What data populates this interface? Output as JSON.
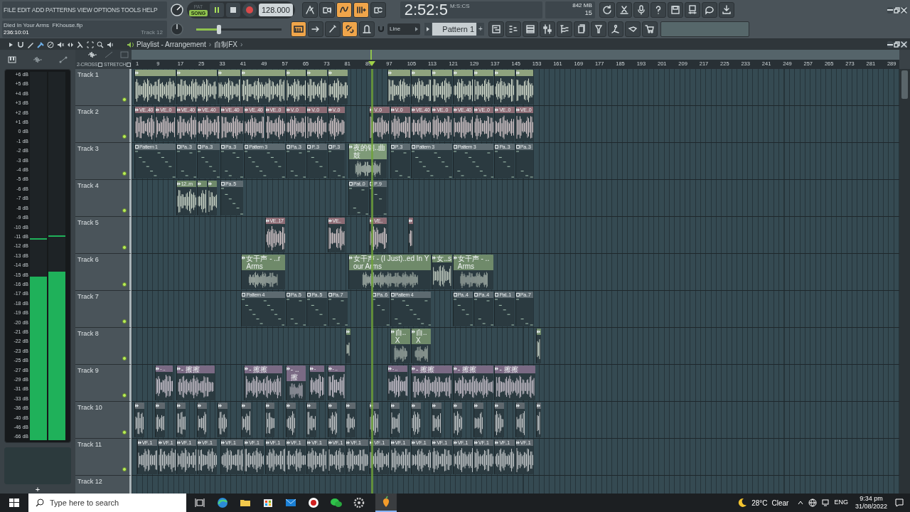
{
  "menu": [
    "FILE",
    "EDIT",
    "ADD",
    "PATTERNS",
    "VIEW",
    "OPTIONS",
    "TOOLS",
    "HELP"
  ],
  "transport": {
    "modes": [
      {
        "label": "PAT",
        "selected": false
      },
      {
        "label": "SONG",
        "selected": true
      }
    ],
    "playing": true,
    "tempo": "128.000"
  },
  "record_toggles": [
    {
      "on": false
    },
    {
      "on": false
    },
    {
      "on": true
    },
    {
      "on": true
    },
    {
      "on": false
    }
  ],
  "clock": {
    "time": "2:52:5",
    "unit": "M:S:CS"
  },
  "monitor": {
    "memory": "842 MB",
    "cpu": "15"
  },
  "hint": {
    "title": "Died In Your Arms  FKhouse.flp",
    "time": "236:10:01",
    "target": "Track 12"
  },
  "master_volume": {
    "level": 0.27
  },
  "snap_toggles": [
    {
      "on": true
    },
    {
      "on": false
    },
    {
      "on": false
    },
    {
      "on": true
    },
    {
      "on": false
    }
  ],
  "snap": {
    "value": "Line"
  },
  "pattern": {
    "name": "Pattern 1",
    "add": "+"
  },
  "playlist": {
    "title": "Playlist - Arrangement",
    "separator": "›",
    "folder": "自制FX",
    "trail": "›",
    "options": [
      {
        "label": "2-CROSS",
        "checked": false
      },
      {
        "label": "STRETCH",
        "checked": false
      }
    ],
    "ruler": [
      "1",
      "9",
      "17",
      "25",
      "33",
      "41",
      "49",
      "57",
      "65",
      "73",
      "81",
      "89",
      "97",
      "105",
      "113",
      "121",
      "129",
      "137",
      "145",
      "153",
      "161",
      "169",
      "177",
      "185",
      "193",
      "201",
      "209",
      "217",
      "225",
      "233",
      "241",
      "249",
      "257",
      "265",
      "273",
      "281",
      "289"
    ],
    "playhead": {
      "level": 0.311
    },
    "tracks": [
      {
        "name": "Track 1",
        "enabled": true,
        "color": "#8fa37e",
        "clips": [
          {
            "kind": "audio"
          },
          {
            "kind": "audio"
          },
          {
            "kind": "audio"
          },
          {
            "kind": "audio"
          },
          {
            "kind": "audio"
          },
          {
            "kind": "audio"
          },
          {
            "kind": "audio"
          },
          {
            "kind": "audio"
          },
          {
            "kind": "audio"
          },
          {
            "kind": "audio"
          },
          {
            "kind": "audio"
          },
          {
            "kind": "audio"
          },
          {
            "kind": "audio"
          },
          {
            "kind": "audio"
          }
        ]
      },
      {
        "name": "Track 2",
        "enabled": true,
        "color": "#8c6b74",
        "clips": [
          {
            "kind": "audio",
            "label": "VE..40"
          },
          {
            "kind": "audio",
            "label": "VE..0"
          },
          {
            "kind": "audio",
            "label": "VE..40"
          },
          {
            "kind": "audio",
            "label": "VE..40"
          },
          {
            "kind": "audio",
            "label": "VE..40"
          },
          {
            "kind": "audio",
            "label": "VE..40"
          },
          {
            "kind": "audio",
            "label": "VE..0"
          },
          {
            "kind": "audio",
            "label": "V..0"
          },
          {
            "kind": "audio",
            "label": "V..0"
          },
          {
            "kind": "audio",
            "label": "V..0"
          },
          {
            "kind": "audio",
            "label": "V..0"
          },
          {
            "kind": "audio",
            "label": "V..0"
          },
          {
            "kind": "audio",
            "label": "VE..40"
          },
          {
            "kind": "audio",
            "label": "VE..0"
          },
          {
            "kind": "audio",
            "label": "VE..40"
          },
          {
            "kind": "audio",
            "label": "VE..0"
          },
          {
            "kind": "audio",
            "label": "VE..0"
          },
          {
            "kind": "audio",
            "label": "VE..0"
          }
        ]
      },
      {
        "name": "Track 3",
        "enabled": true,
        "color": "#5d6a70",
        "clips": [
          {
            "kind": "pattern",
            "label": "Pattern 1"
          },
          {
            "kind": "pattern",
            "label": "Pa..3"
          },
          {
            "kind": "pattern",
            "label": "Pa..3"
          },
          {
            "kind": "pattern",
            "label": "Pa..3"
          },
          {
            "kind": "pattern",
            "label": "Pattern 3"
          },
          {
            "kind": "pattern",
            "label": "Pa..3"
          },
          {
            "kind": "pattern",
            "label": "P..3"
          },
          {
            "kind": "pattern",
            "label": "P..3"
          },
          {
            "kind": "audio",
            "label": "夜的钢..曲鼓",
            "color": "#7e9a78"
          },
          {
            "kind": "pattern",
            "label": "P..3"
          },
          {
            "kind": "pattern",
            "label": "Pattern 3"
          },
          {
            "kind": "pattern",
            "label": "Pattern 3"
          },
          {
            "kind": "pattern",
            "label": "Pa..3"
          },
          {
            "kind": "pattern",
            "label": "Pa..3"
          }
        ]
      },
      {
        "name": "Track 4",
        "enabled": true,
        "color": "#6f8a6a",
        "clips": [
          {
            "kind": "audio",
            "label": "12..m"
          },
          {
            "kind": "audio"
          },
          {
            "kind": "audio"
          },
          {
            "kind": "pattern",
            "label": "Pa..5",
            "color": "#5d6a70"
          },
          {
            "kind": "pattern",
            "label": "Pat..0",
            "color": "#5d6a70"
          },
          {
            "kind": "pattern",
            "label": "P..9",
            "color": "#5d6a70"
          }
        ]
      },
      {
        "name": "Track 5",
        "enabled": true,
        "color": "#8c6b74",
        "clips": [
          {
            "kind": "audio",
            "label": "VE..17"
          },
          {
            "kind": "audio",
            "label": "VE.."
          },
          {
            "kind": "audio",
            "label": "VE.."
          },
          {
            "kind": "audio"
          }
        ]
      },
      {
        "name": "Track 6",
        "enabled": true,
        "color": "#6f8a6a",
        "clips": [
          {
            "kind": "audio",
            "label": "女干声 - ..r Arms"
          },
          {
            "kind": "audio",
            "label": "女干声 - (I Just)..ed In Your Arms"
          },
          {
            "kind": "audio",
            "label": "女..s"
          },
          {
            "kind": "audio",
            "label": "女干声 - ..Arms"
          }
        ]
      },
      {
        "name": "Track 7",
        "enabled": true,
        "color": "#5d6a70",
        "clips": [
          {
            "kind": "pattern",
            "label": "Pattern 4"
          },
          {
            "kind": "pattern",
            "label": "Pa..5"
          },
          {
            "kind": "pattern",
            "label": "Pa..5"
          },
          {
            "kind": "pattern",
            "label": "Pa..7"
          },
          {
            "kind": "pattern",
            "label": "Pa..6"
          },
          {
            "kind": "pattern",
            "label": "Pattern 4"
          },
          {
            "kind": "pattern",
            "label": "Pa..4"
          },
          {
            "kind": "pattern",
            "label": "Pa..4"
          },
          {
            "kind": "pattern",
            "label": "Pat..1"
          },
          {
            "kind": "pattern",
            "label": "Pa..7"
          }
        ]
      },
      {
        "name": "Track 8",
        "enabled": true,
        "color": "#6f8a6a",
        "clips": [
          {
            "kind": "audio"
          },
          {
            "kind": "audio",
            "label": "自..X"
          },
          {
            "kind": "audio",
            "label": "自..X"
          },
          {
            "kind": "audio"
          }
        ]
      },
      {
        "name": "Track 9",
        "enabled": true,
        "color": "#7a6a84",
        "clips": [
          {
            "kind": "audio",
            "label": "- .."
          },
          {
            "kind": "audio",
            "label": "- 擦擦"
          },
          {
            "kind": "audio",
            "label": "- 擦擦"
          },
          {
            "kind": "audio",
            "label": "- ..擦"
          },
          {
            "kind": "audio",
            "label": "-"
          },
          {
            "kind": "audio",
            "label": "- .."
          },
          {
            "kind": "audio",
            "label": "- .."
          },
          {
            "kind": "audio",
            "label": "- 擦擦"
          },
          {
            "kind": "audio",
            "label": "- 擦擦"
          },
          {
            "kind": "audio",
            "label": "- 擦擦"
          }
        ]
      },
      {
        "name": "Track 10",
        "enabled": true,
        "color": "#5f686e",
        "clips": [
          {
            "kind": "audio"
          },
          {
            "kind": "audio"
          },
          {
            "kind": "audio"
          },
          {
            "kind": "audio"
          },
          {
            "kind": "audio"
          },
          {
            "kind": "audio"
          },
          {
            "kind": "audio"
          },
          {
            "kind": "audio"
          },
          {
            "kind": "audio"
          },
          {
            "kind": "audio"
          },
          {
            "kind": "audio"
          },
          {
            "kind": "audio"
          },
          {
            "kind": "audio"
          },
          {
            "kind": "audio"
          },
          {
            "kind": "audio"
          },
          {
            "kind": "audio"
          },
          {
            "kind": "audio"
          },
          {
            "kind": "audio"
          },
          {
            "kind": "audio"
          },
          {
            "kind": "audio"
          }
        ]
      },
      {
        "name": "Track 11",
        "enabled": true,
        "color": "#5f686e",
        "clips": [
          {
            "kind": "audio",
            "label": "VF..1"
          },
          {
            "kind": "audio",
            "label": "VF..1"
          },
          {
            "kind": "audio",
            "label": "VF..1"
          },
          {
            "kind": "audio",
            "label": "VF..1"
          },
          {
            "kind": "audio",
            "label": "VF..1"
          },
          {
            "kind": "audio",
            "label": "VF..1"
          },
          {
            "kind": "audio",
            "label": "VF..1"
          },
          {
            "kind": "audio",
            "label": "VF..1"
          },
          {
            "kind": "audio",
            "label": "VF..1"
          },
          {
            "kind": "audio",
            "label": "VF..1"
          },
          {
            "kind": "audio",
            "label": "VF..1"
          },
          {
            "kind": "audio",
            "label": "VF..1"
          },
          {
            "kind": "audio",
            "label": "VF..1"
          },
          {
            "kind": "audio",
            "label": "VF..1"
          },
          {
            "kind": "audio",
            "label": "VF..1"
          },
          {
            "kind": "audio",
            "label": "VF..1"
          },
          {
            "kind": "audio",
            "label": "VF..1"
          },
          {
            "kind": "audio",
            "label": "VF..1"
          },
          {
            "kind": "audio",
            "label": "VF..1"
          }
        ]
      },
      {
        "name": "Track 12"
      }
    ]
  },
  "meters": {
    "scale": [
      "+6 dB",
      "+5 dB",
      "+4 dB",
      "+3 dB",
      "+2 dB",
      "+1 dB",
      "0 dB",
      "-1 dB",
      "-2 dB",
      "-3 dB",
      "-4 dB",
      "-5 dB",
      "-6 dB",
      "-7 dB",
      "-8 dB",
      "-9 dB",
      "-10 dB",
      "-11 dB",
      "-12 dB",
      "-13 dB",
      "-14 dB",
      "-15 dB",
      "-16 dB",
      "-17 dB",
      "-18 dB",
      "-19 dB",
      "-20 dB",
      "-21 dB",
      "-22 dB",
      "-23 dB",
      "-25 dB",
      "-27 dB",
      "-29 dB",
      "-31 dB",
      "-33 dB",
      "-36 dB",
      "-40 dB",
      "-46 dB",
      "-66 dB"
    ],
    "channels": [
      {
        "level": 0.445,
        "peak": {
          "level": 0.545
        }
      },
      {
        "level": 0.457,
        "peak": {
          "level": 0.552
        }
      }
    ],
    "add": "+"
  },
  "taskbar": {
    "search": {
      "placeholder": "Type here to search"
    },
    "weather": {
      "temperature": "28°C",
      "condition": "Clear"
    },
    "language": "ENG",
    "time": "9:34 pm",
    "date": "31/08/2022"
  }
}
